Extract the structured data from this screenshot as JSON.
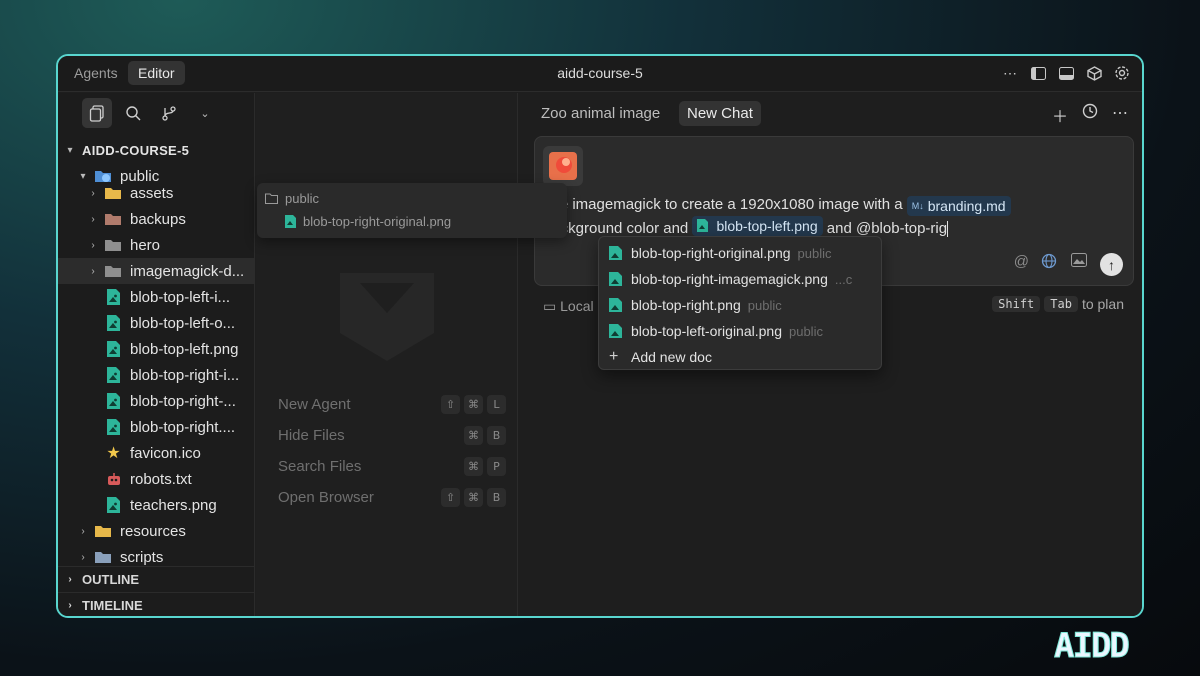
{
  "titlebar": {
    "tabs": [
      "Agents",
      "Editor"
    ],
    "title": "aidd-course-5",
    "icons": [
      "more-icon",
      "sidebar-left-icon",
      "panel-bottom-icon",
      "cube-icon",
      "settings-icon"
    ]
  },
  "explorer": {
    "root": "AIDD-COURSE-5",
    "public": "public",
    "items": [
      "assets",
      "backups",
      "hero",
      "imagemagick-d...",
      "blob-top-left-i...",
      "blob-top-left-o...",
      "blob-top-left.png",
      "blob-top-right-i...",
      "blob-top-right-...",
      "blob-top-right....",
      "favicon.ico",
      "robots.txt",
      "teachers.png"
    ],
    "after": [
      "resources",
      "scripts"
    ],
    "sections": [
      "OUTLINE",
      "TIMELINE"
    ]
  },
  "shortcuts": [
    {
      "label": "New Agent",
      "keys": [
        "⇧",
        "⌘",
        "L"
      ]
    },
    {
      "label": "Hide Files",
      "keys": [
        "⌘",
        "B"
      ]
    },
    {
      "label": "Search Files",
      "keys": [
        "⌘",
        "P"
      ]
    },
    {
      "label": "Open Browser",
      "keys": [
        "⇧",
        "⌘",
        "B"
      ]
    }
  ],
  "drag_popup": {
    "folder": "public",
    "file": "blob-top-right-original.png"
  },
  "chat": {
    "tabs": [
      "Zoo animal image",
      "New Chat"
    ],
    "message": {
      "part1": "use imagemagick to create a 1920x1080 image with a",
      "pill1": "branding.md",
      "pill1_badge": "M↓",
      "part2": "background color and",
      "pill2": "blob-top-left.png",
      "part3": "and @blob-top-rig"
    },
    "local_label": "Local",
    "hint": {
      "key1": "Shift",
      "key2": "Tab",
      "text": "to plan"
    }
  },
  "mention_dropdown": {
    "items": [
      {
        "name": "blob-top-right-original.png",
        "path": "public"
      },
      {
        "name": "blob-top-right-imagemagick.png",
        "path": "...c"
      },
      {
        "name": "blob-top-right.png",
        "path": "public"
      },
      {
        "name": "blob-top-left-original.png",
        "path": "public"
      }
    ],
    "add_label": "Add new doc"
  },
  "brand": "AIDD",
  "colors": {
    "accent_border": "#59d6cf",
    "pill_bg": "#23384d",
    "image_icon": "#2db59a"
  }
}
